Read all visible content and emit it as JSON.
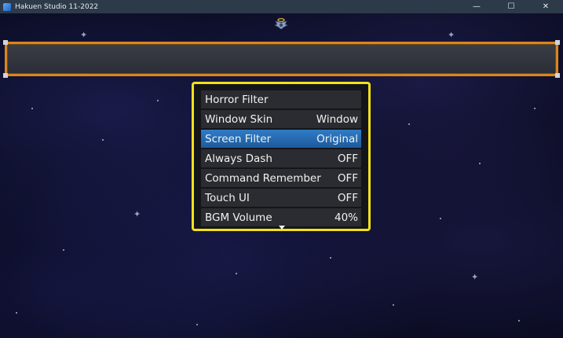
{
  "window": {
    "title": "Hakuen Studio 11-2022",
    "icons": {
      "app": "app-icon",
      "minimize": "minimize-icon",
      "maximize": "maximize-icon",
      "close": "close-icon"
    },
    "glyphs": {
      "minimize": "—",
      "maximize": "☐",
      "close": "✕"
    }
  },
  "game": {
    "emblem_icon": "winged-emblem-icon",
    "help_window_text": "",
    "options": [
      {
        "label": "Horror Filter",
        "value": ""
      },
      {
        "label": "Window Skin",
        "value": "Window"
      },
      {
        "label": "Screen Filter",
        "value": "Original",
        "selected": true
      },
      {
        "label": "Always Dash",
        "value": "OFF"
      },
      {
        "label": "Command Remember",
        "value": "OFF"
      },
      {
        "label": "Touch UI",
        "value": "OFF"
      },
      {
        "label": "BGM Volume",
        "value": "40%"
      }
    ],
    "scroll_indicator_icon": "scroll-down-arrow-icon"
  },
  "colors": {
    "titlebar": "#2c3a4a",
    "help_window_border": "#d9861c",
    "options_window_border": "#f1e11c",
    "selected_row": "#2f7cc7"
  }
}
